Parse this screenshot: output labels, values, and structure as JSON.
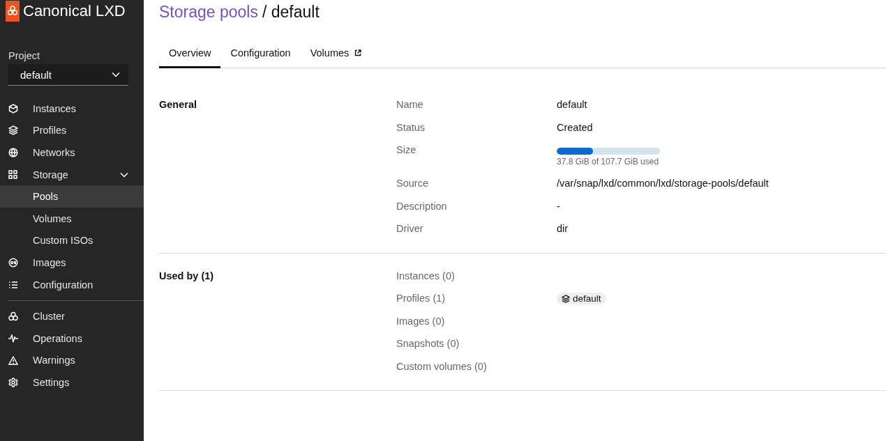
{
  "brand": {
    "name": "Canonical LXD"
  },
  "project": {
    "label": "Project",
    "value": "default"
  },
  "nav": {
    "main": [
      {
        "label": "Instances",
        "selected": false
      },
      {
        "label": "Profiles",
        "selected": false
      },
      {
        "label": "Networks",
        "selected": false
      },
      {
        "label": "Storage",
        "selected": false,
        "expanded": true,
        "children": [
          {
            "label": "Pools",
            "selected": true
          },
          {
            "label": "Volumes",
            "selected": false
          },
          {
            "label": "Custom ISOs",
            "selected": false
          }
        ]
      },
      {
        "label": "Images",
        "selected": false
      },
      {
        "label": "Configuration",
        "selected": false
      }
    ],
    "system": [
      {
        "label": "Cluster",
        "selected": false
      },
      {
        "label": "Operations",
        "selected": false
      },
      {
        "label": "Warnings",
        "selected": false
      },
      {
        "label": "Settings",
        "selected": false
      }
    ]
  },
  "breadcrumb": {
    "parent": "Storage pools",
    "separator": "/",
    "current": "default"
  },
  "tabs": [
    {
      "label": "Overview",
      "selected": true,
      "external": false
    },
    {
      "label": "Configuration",
      "selected": false,
      "external": false
    },
    {
      "label": "Volumes",
      "selected": false,
      "external": true
    }
  ],
  "sections": [
    {
      "title": "General",
      "rows": [
        {
          "kind": "text",
          "label": "Name",
          "value": "default"
        },
        {
          "kind": "text",
          "label": "Status",
          "value": "Created"
        },
        {
          "kind": "meter",
          "label": "Size",
          "level": 0.35,
          "caption": "37.8 GiB of 107.7 GiB used"
        },
        {
          "kind": "text",
          "label": "Source",
          "value": "/var/snap/lxd/common/lxd/storage-pools/default"
        },
        {
          "kind": "text",
          "label": "Description",
          "value": "-"
        },
        {
          "kind": "text",
          "label": "Driver",
          "value": "dir"
        }
      ]
    },
    {
      "title": "Used by (1)",
      "rows": [
        {
          "kind": "chips",
          "label": "Instances (0)"
        },
        {
          "kind": "chips",
          "label": "Profiles (1)",
          "chips": [
            "default"
          ]
        },
        {
          "kind": "chips",
          "label": "Images (0)"
        },
        {
          "kind": "chips",
          "label": "Snapshots (0)"
        },
        {
          "kind": "chips",
          "label": "Custom volumes (0)"
        }
      ]
    }
  ]
}
